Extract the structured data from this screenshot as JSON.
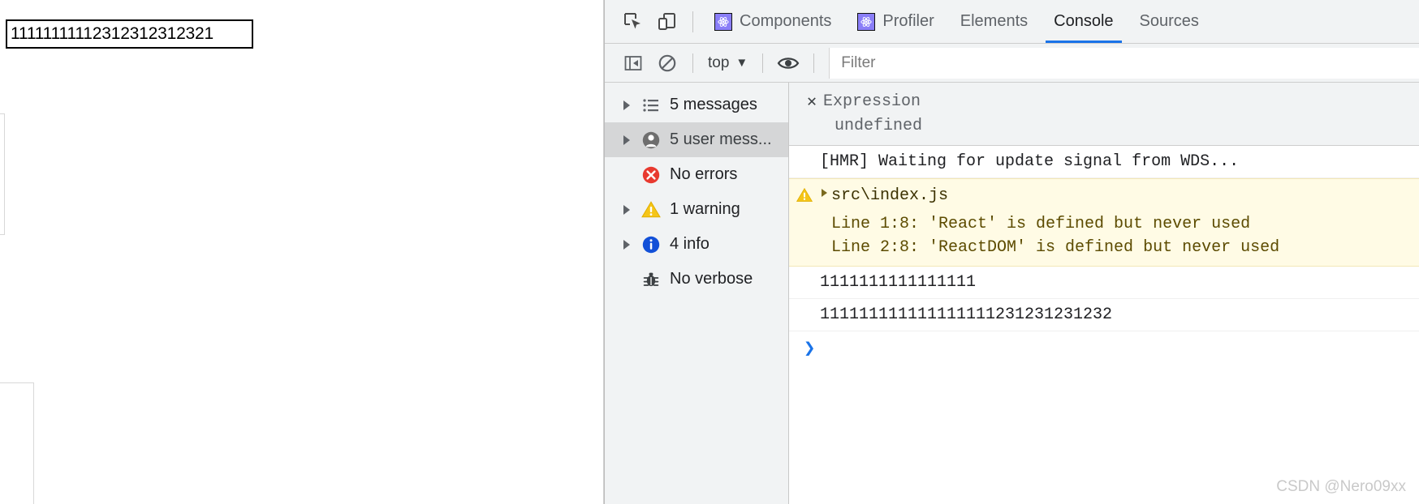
{
  "page": {
    "input_value": "11111111112312312312321",
    "input_placeholder": ""
  },
  "devtools": {
    "toolbar": {
      "inspect_icon": "inspect-cursor-icon",
      "device_icon": "device-toolbar-icon",
      "tabs": [
        {
          "label": "Components",
          "icon": "react-atom-icon",
          "active": false
        },
        {
          "label": "Profiler",
          "icon": "react-atom-icon",
          "active": false
        },
        {
          "label": "Elements",
          "icon": "",
          "active": false
        },
        {
          "label": "Console",
          "icon": "",
          "active": true
        },
        {
          "label": "Sources",
          "icon": "",
          "active": false
        }
      ],
      "accent_color": "#1a73e8"
    },
    "filterbar": {
      "sidebar_toggle_icon": "show-console-sidebar-icon",
      "clear_icon": "clear-console-icon",
      "context_label": "top",
      "context_caret": "▼",
      "eye_icon": "live-expression-eye-icon",
      "filter_placeholder": "Filter",
      "filter_value": ""
    },
    "sidebar": [
      {
        "label": "5 messages",
        "icon": "list-icon",
        "caret": true,
        "selected": false
      },
      {
        "label": "5 user mess...",
        "icon": "user-icon",
        "caret": true,
        "selected": true
      },
      {
        "label": "No errors",
        "icon": "error-icon",
        "caret": false,
        "selected": false
      },
      {
        "label": "1 warning",
        "icon": "warning-icon",
        "caret": true,
        "selected": false
      },
      {
        "label": "4 info",
        "icon": "info-icon",
        "caret": true,
        "selected": false
      },
      {
        "label": "No verbose",
        "icon": "verbose-bug-icon",
        "caret": false,
        "selected": false
      }
    ],
    "live_expression": {
      "close_label": "✕",
      "name": "Expression",
      "value": "undefined"
    },
    "console_messages": [
      {
        "kind": "info",
        "text": "[HMR] Waiting for update signal from WDS..."
      },
      {
        "kind": "warning",
        "file": "src\\index.js",
        "lines": [
          "Line 1:8:  'React' is defined but never used",
          "Line 2:8:  'ReactDOM' is defined but never used"
        ]
      },
      {
        "kind": "log",
        "text": "1111111111111111"
      },
      {
        "kind": "log",
        "text": "111111111111111111231231231232"
      }
    ],
    "prompt_symbol": "❯"
  },
  "watermark": "CSDN @Nero09xx"
}
